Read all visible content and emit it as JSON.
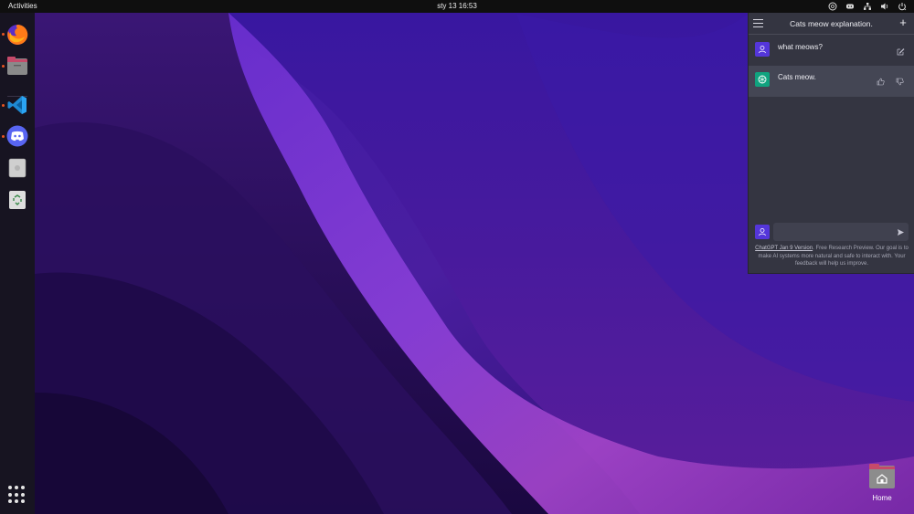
{
  "topbar": {
    "activities": "Activities",
    "clock": "sty 13  16:53",
    "tray": [
      "chatgpt-icon",
      "discord-icon",
      "network-icon",
      "volume-icon",
      "power-icon"
    ]
  },
  "dock": {
    "apps": [
      {
        "name": "firefox",
        "running": true
      },
      {
        "name": "files",
        "running": true
      },
      {
        "name": "vscode",
        "running": true
      },
      {
        "name": "discord",
        "running": true
      },
      {
        "name": "disk-image",
        "running": false
      },
      {
        "name": "trash",
        "running": false
      }
    ],
    "show_apps": "show-applications-icon"
  },
  "chat": {
    "title": "Cats meow explanation.",
    "messages": [
      {
        "role": "user",
        "text": "what meows?"
      },
      {
        "role": "assistant",
        "text": "Cats meow."
      }
    ],
    "input": {
      "value": "",
      "placeholder": ""
    },
    "footer": {
      "link": "ChatGPT Jan 9 Version",
      "text": ". Free Research Preview. Our goal is to make AI systems more natural and safe to interact with. Your feedback will help us improve."
    },
    "colors": {
      "panel": "#343541",
      "assistant_row": "#444654",
      "user_avatar": "#5436da",
      "bot_avatar": "#10a37f"
    }
  },
  "desktop": {
    "home_label": "Home"
  }
}
